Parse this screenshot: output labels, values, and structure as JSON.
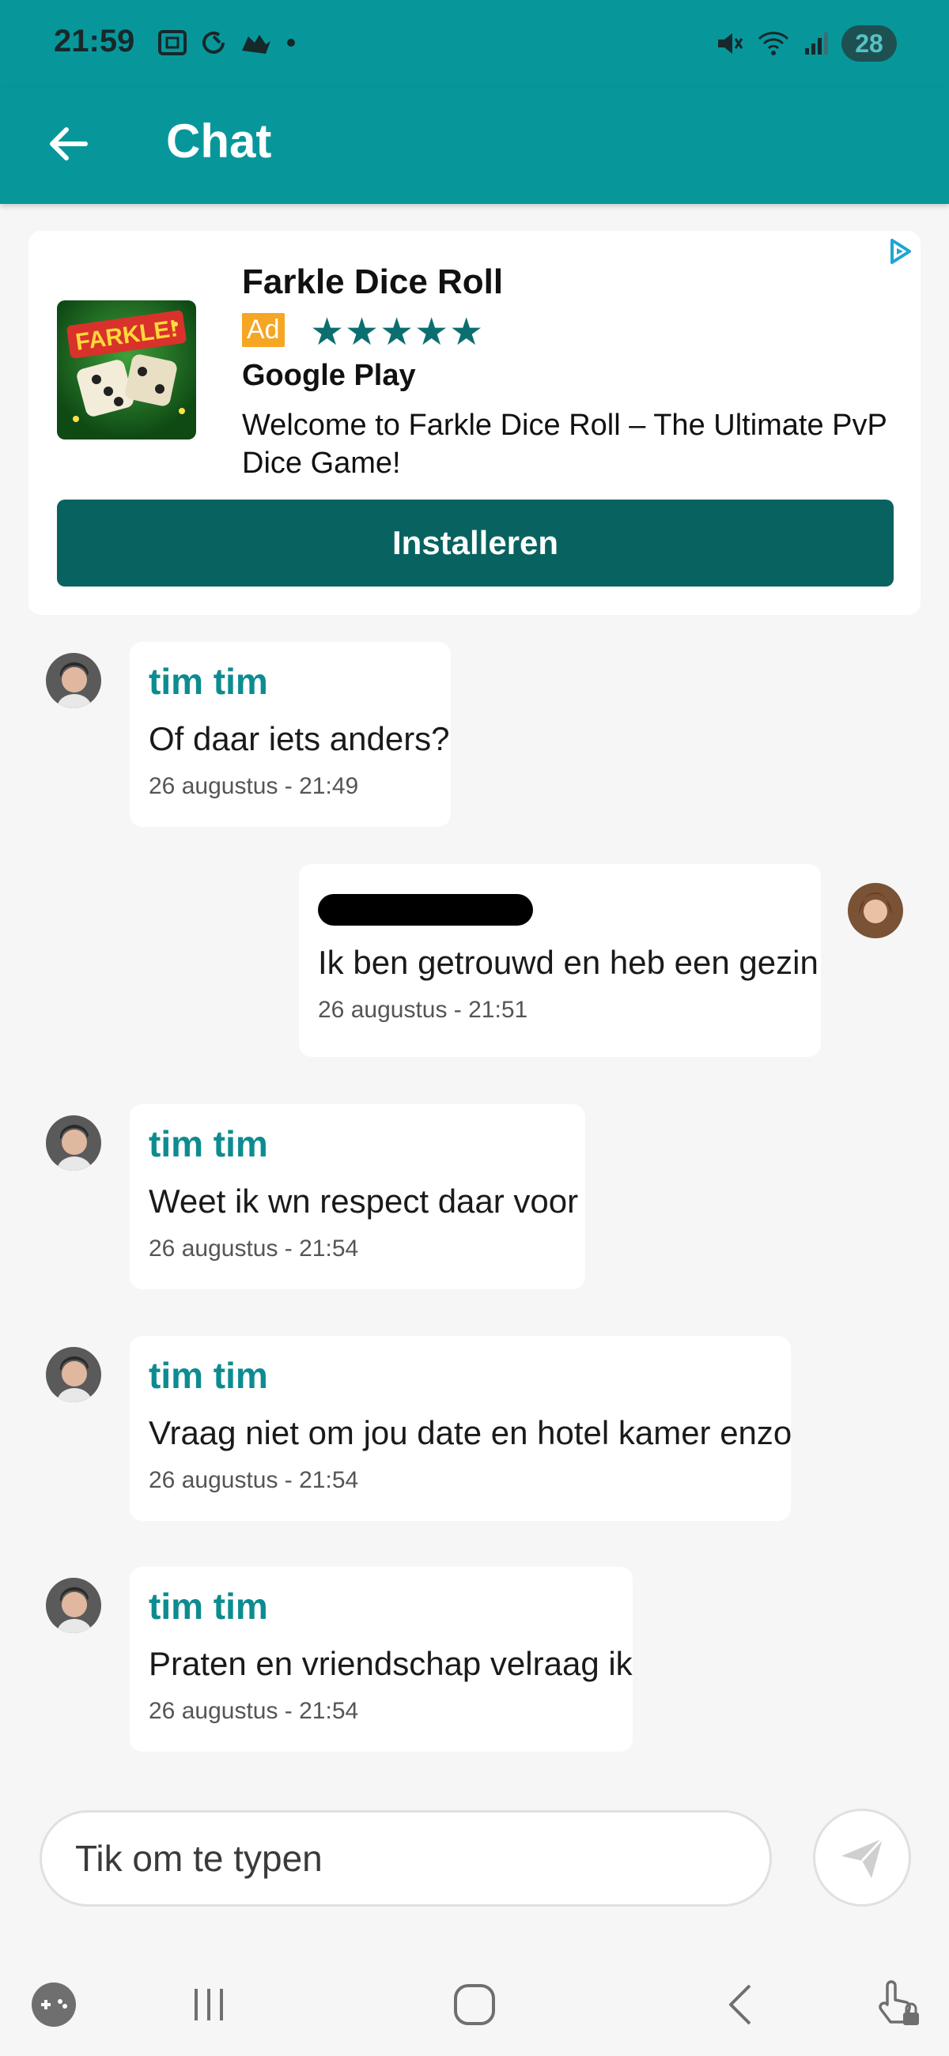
{
  "status_bar": {
    "time": "21:59",
    "battery": "28"
  },
  "app_bar": {
    "title": "Chat"
  },
  "ad": {
    "app_name": "Farkle Dice Roll",
    "ad_label": "Ad",
    "rating_stars": "★★★★★",
    "publisher": "Google Play",
    "description": "Welcome to Farkle Dice Roll – The Ultimate PvP Dice Game!",
    "icon_text": "FARKLE!",
    "install_label": "Installeren"
  },
  "messages": [
    {
      "sender": "tim tim",
      "text": "Of daar iets anders?",
      "time": "26 augustus - 21:49",
      "side": "left"
    },
    {
      "sender": "",
      "text": "Ik ben getrouwd en heb een gezin",
      "time": "26 augustus - 21:51",
      "side": "right"
    },
    {
      "sender": "tim tim",
      "text": "Weet ik wn respect daar voor",
      "time": "26 augustus - 21:54",
      "side": "left"
    },
    {
      "sender": "tim tim",
      "text": "Vraag niet om jou date en hotel kamer enzo",
      "time": "26 augustus - 21:54",
      "side": "left"
    },
    {
      "sender": "tim tim",
      "text": "Praten en vriendschap velraag ik",
      "time": "26 augustus - 21:54",
      "side": "left"
    }
  ],
  "composer": {
    "placeholder": "Tik om te typen"
  },
  "colors": {
    "primary": "#07979b",
    "install_button": "#08625f",
    "sender_name": "#0d8c90",
    "ad_badge": "#f5a623"
  }
}
